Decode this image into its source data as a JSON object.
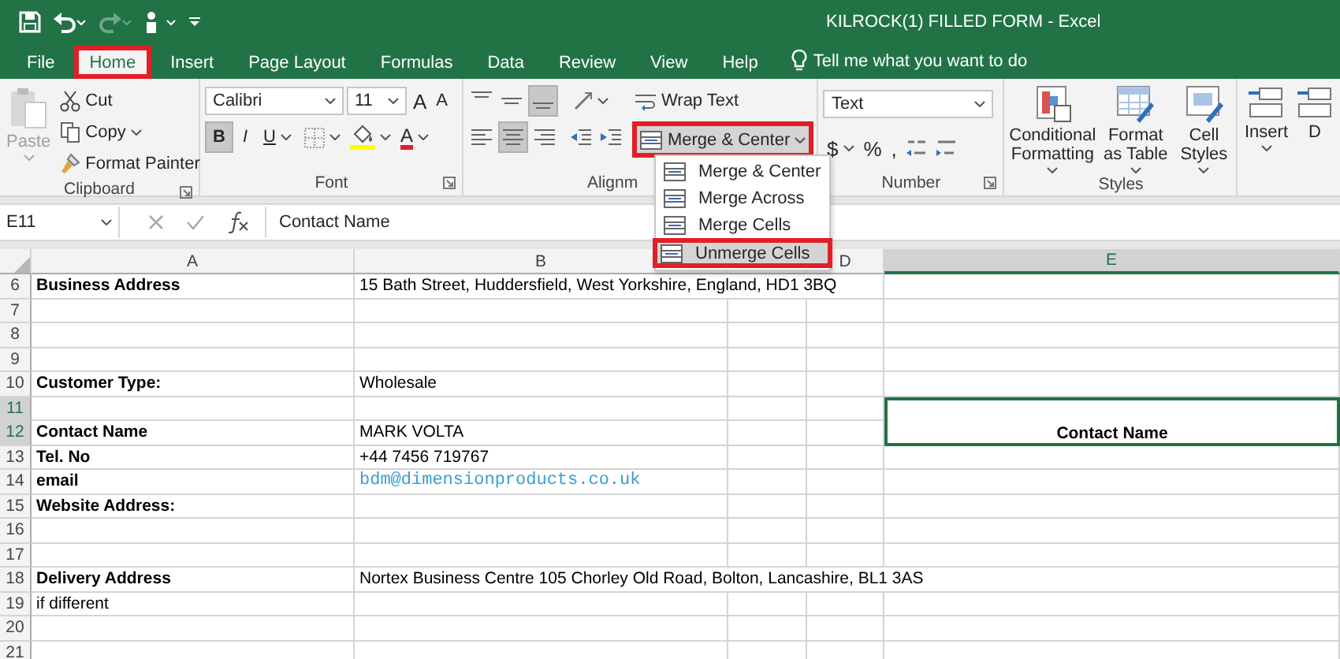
{
  "window": {
    "title": "KILROCK(1) FILLED FORM  -  Excel"
  },
  "quick_access": [
    {
      "kind": "save",
      "disabled": false
    },
    {
      "kind": "undo",
      "disabled": false
    },
    {
      "kind": "redo",
      "disabled": true
    },
    {
      "kind": "touch",
      "disabled": false
    },
    {
      "kind": "customize",
      "disabled": false
    }
  ],
  "tabs": [
    {
      "label": "File",
      "selected": false,
      "annotated": false
    },
    {
      "label": "Home",
      "selected": true,
      "annotated": true
    },
    {
      "label": "Insert",
      "selected": false,
      "annotated": false
    },
    {
      "label": "Page Layout",
      "selected": false,
      "annotated": false
    },
    {
      "label": "Formulas",
      "selected": false,
      "annotated": false
    },
    {
      "label": "Data",
      "selected": false,
      "annotated": false
    },
    {
      "label": "Review",
      "selected": false,
      "annotated": false
    },
    {
      "label": "View",
      "selected": false,
      "annotated": false
    },
    {
      "label": "Help",
      "selected": false,
      "annotated": false
    }
  ],
  "tell_me": {
    "placeholder": "Tell me what you want to do"
  },
  "clipboard": {
    "label": "Clipboard",
    "paste": {
      "label": "Paste",
      "disabled": true
    },
    "items": [
      "Cut",
      "Copy",
      "Format Painter"
    ]
  },
  "font": {
    "label": "Font",
    "name": "Calibri",
    "size": "11",
    "size_buttons": [
      "A",
      "A"
    ],
    "styles": [
      {
        "label": "B",
        "kind": "bold",
        "selected": true
      },
      {
        "label": "I",
        "kind": "italic",
        "selected": false
      },
      {
        "label": "U",
        "kind": "underline",
        "selected": false
      }
    ],
    "font_color": "A"
  },
  "alignment": {
    "label": "Alignm",
    "vertical": [
      {
        "kind": "top",
        "selected": false
      },
      {
        "kind": "middle",
        "selected": false
      },
      {
        "kind": "bottom",
        "selected": true
      }
    ],
    "horizontal": [
      {
        "kind": "left",
        "selected": false
      },
      {
        "kind": "center",
        "selected": true
      },
      {
        "kind": "right",
        "selected": false
      }
    ],
    "wrap_text": "Wrap Text",
    "merge": {
      "label": "Merge & Center",
      "open": true,
      "annotated": true
    },
    "merge_menu": [
      {
        "label": "Merge & Center",
        "annotated": false
      },
      {
        "label": "Merge Across",
        "annotated": false
      },
      {
        "label": "Merge Cells",
        "annotated": false
      },
      {
        "label": "Unmerge Cells",
        "annotated": true
      }
    ]
  },
  "number": {
    "label": "Number",
    "format": "Text",
    "symbols": [
      "$",
      "%",
      ","
    ]
  },
  "styles": {
    "label": "Styles",
    "buttons": [
      "Conditional Formatting",
      "Format as Table",
      "Cell Styles"
    ]
  },
  "cells": {
    "buttons": [
      "Insert",
      "D"
    ]
  },
  "formula_bar": {
    "name_box": "E11",
    "value": "Contact Name"
  },
  "sheet": {
    "columns": [
      {
        "label": "A",
        "selected": false
      },
      {
        "label": "B",
        "selected": false
      },
      {},
      {
        "label": "D",
        "selected": false
      },
      {
        "label": "E",
        "selected": true
      }
    ],
    "active_cell": {
      "text": "Contact Name"
    },
    "rows": [
      {
        "number": "6",
        "selected": false,
        "cells": [
          {
            "text": "Business Address",
            "bold": true,
            "kind": "text"
          },
          {
            "text": "15 Bath Street, Huddersfield, West Yorkshire, England, HD1 3BQ",
            "bold": false,
            "kind": "text"
          }
        ]
      },
      {
        "number": "7",
        "selected": false,
        "cells": []
      },
      {
        "number": "8",
        "selected": false,
        "cells": []
      },
      {
        "number": "9",
        "selected": false,
        "cells": []
      },
      {
        "number": "10",
        "selected": false,
        "cells": [
          {
            "text": "Customer Type:",
            "bold": true,
            "kind": "text"
          },
          {
            "text": "Wholesale",
            "bold": false,
            "kind": "text"
          }
        ]
      },
      {
        "number": "11",
        "selected": true,
        "cells": []
      },
      {
        "number": "12",
        "selected": true,
        "cells": [
          {
            "text": "Contact Name",
            "bold": true,
            "kind": "text"
          },
          {
            "text": "MARK VOLTA",
            "bold": false,
            "kind": "text"
          }
        ]
      },
      {
        "number": "13",
        "selected": false,
        "cells": [
          {
            "text": "Tel. No",
            "bold": true,
            "kind": "text"
          },
          {
            "text": "+44 7456 719767",
            "bold": false,
            "kind": "text"
          }
        ]
      },
      {
        "number": "14",
        "selected": false,
        "cells": [
          {
            "text": "email",
            "bold": true,
            "kind": "text"
          },
          {
            "text": "bdm@dimensionproducts.co.uk",
            "bold": false,
            "kind": "link"
          }
        ]
      },
      {
        "number": "15",
        "selected": false,
        "cells": [
          {
            "text": "Website Address:",
            "bold": true,
            "kind": "text"
          }
        ]
      },
      {
        "number": "16",
        "selected": false,
        "cells": []
      },
      {
        "number": "17",
        "selected": false,
        "cells": []
      },
      {
        "number": "18",
        "selected": false,
        "cells": [
          {
            "text": "Delivery Address",
            "bold": true,
            "kind": "text"
          },
          {
            "text": "Nortex Business Centre 105 Chorley Old Road, Bolton, Lancashire, BL1 3AS",
            "bold": false,
            "kind": "text"
          }
        ]
      },
      {
        "number": "19",
        "selected": false,
        "cells": [
          {
            "text": "if different",
            "bold": false,
            "kind": "text"
          }
        ]
      },
      {
        "number": "20",
        "selected": false,
        "cells": []
      },
      {
        "number": "21",
        "selected": false,
        "cells": []
      }
    ]
  }
}
